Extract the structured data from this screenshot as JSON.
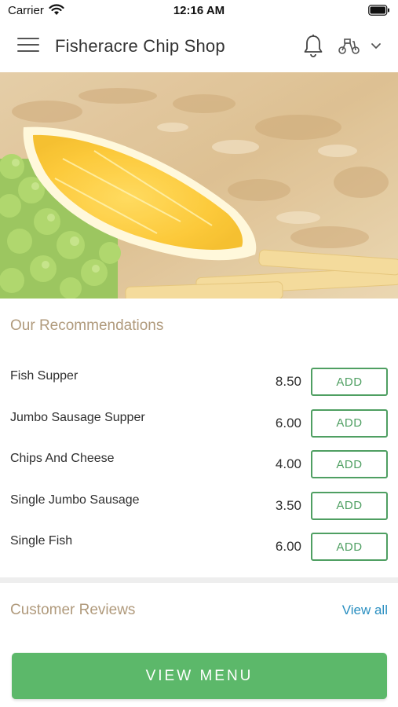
{
  "status_bar": {
    "carrier": "Carrier",
    "time": "12:16 AM"
  },
  "header": {
    "title": "Fisheracre Chip Shop",
    "icons": [
      "menu-icon",
      "bell-icon",
      "delivery-scooter-icon",
      "chevron-down-icon"
    ]
  },
  "hero": {
    "image": "fish-and-chips-with-lemon-and-peas"
  },
  "recommendations": {
    "title": "Our Recommendations",
    "items": [
      {
        "name": "Fish Supper",
        "price": "8.50",
        "button": "ADD"
      },
      {
        "name": "Jumbo Sausage Supper",
        "price": "6.00",
        "button": "ADD"
      },
      {
        "name": "Chips And Cheese",
        "price": "4.00",
        "button": "ADD"
      },
      {
        "name": "Single Jumbo Sausage",
        "price": "3.50",
        "button": "ADD"
      },
      {
        "name": "Single Fish",
        "price": "6.00",
        "button": "ADD"
      }
    ]
  },
  "reviews": {
    "title": "Customer Reviews",
    "view_all": "View all"
  },
  "footer": {
    "view_menu": "VIEW MENU"
  },
  "colors": {
    "accent_green": "#5cb86a",
    "section_title": "#b09a7c",
    "link_blue": "#2a8fc1"
  }
}
